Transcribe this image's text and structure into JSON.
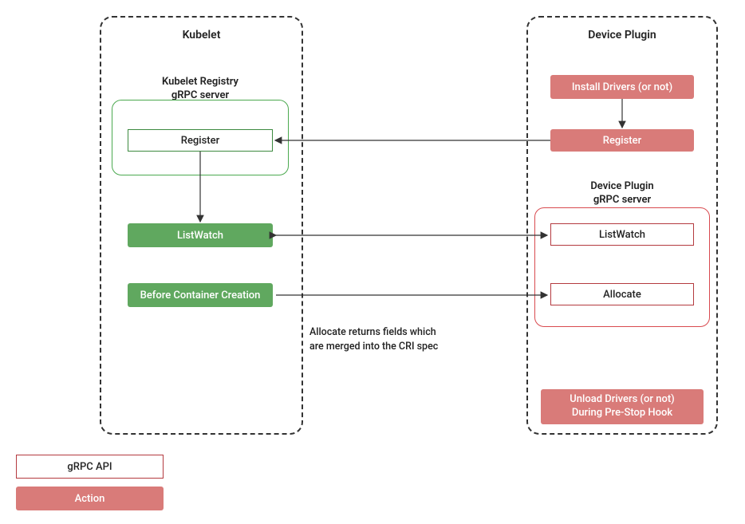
{
  "columns": {
    "left": {
      "title": "Kubelet"
    },
    "right": {
      "title": "Device Plugin"
    }
  },
  "kubelet_registry": {
    "heading_line1": "Kubelet Registry",
    "heading_line2": "gRPC server",
    "register": "Register"
  },
  "kubelet_actions": {
    "listwatch": "ListWatch",
    "before_container": "Before Container Creation"
  },
  "device_plugin": {
    "install_drivers": "Install Drivers (or not)",
    "register": "Register",
    "grpc_heading_line1": "Device Plugin",
    "grpc_heading_line2": "gRPC server",
    "listwatch": "ListWatch",
    "allocate": "Allocate",
    "unload_drivers_line1": "Unload Drivers (or not)",
    "unload_drivers_line2": "During Pre-Stop Hook"
  },
  "annotation": {
    "line1": "Allocate returns fields which",
    "line2": "are merged into the CRI spec"
  },
  "legend": {
    "api": "gRPC API",
    "action": "Action"
  }
}
